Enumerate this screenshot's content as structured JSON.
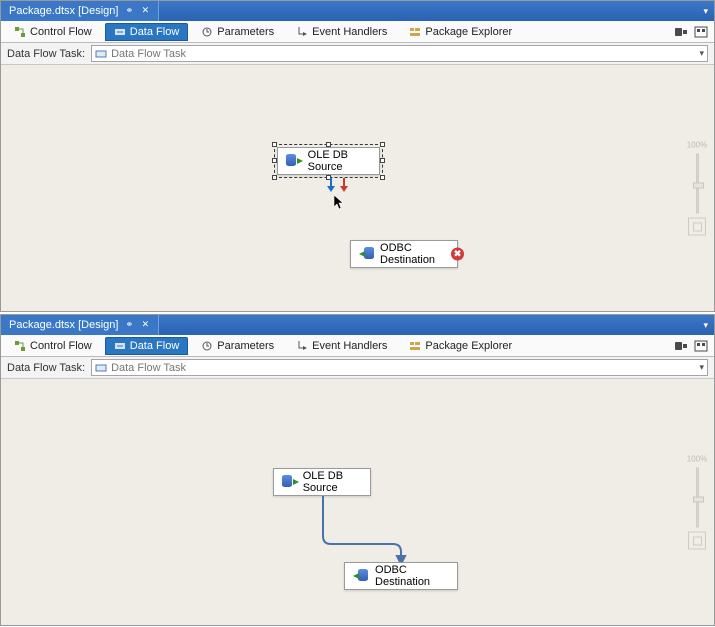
{
  "panels": [
    {
      "titleTab": {
        "label": "Package.dtsx [Design]",
        "pinGlyph": "⚭",
        "closeGlyph": "✕"
      },
      "tabs": {
        "controlFlow": "Control Flow",
        "dataFlow": "Data Flow",
        "parameters": "Parameters",
        "eventHandlers": "Event Handlers",
        "packageExplorer": "Package Explorer"
      },
      "toolbar": {
        "label": "Data Flow Task:",
        "selected": "Data Flow Task"
      },
      "nodes": {
        "source": {
          "label": "OLE DB Source"
        },
        "dest": {
          "label": "ODBC Destination",
          "errorGlyph": "✖"
        }
      },
      "zoom": {
        "percent": "100%"
      }
    },
    {
      "titleTab": {
        "label": "Package.dtsx [Design]",
        "pinGlyph": "⚭",
        "closeGlyph": "✕"
      },
      "tabs": {
        "controlFlow": "Control Flow",
        "dataFlow": "Data Flow",
        "parameters": "Parameters",
        "eventHandlers": "Event Handlers",
        "packageExplorer": "Package Explorer"
      },
      "toolbar": {
        "label": "Data Flow Task:",
        "selected": "Data Flow Task"
      },
      "nodes": {
        "source": {
          "label": "OLE DB Source"
        },
        "dest": {
          "label": "ODBC Destination"
        }
      },
      "zoom": {
        "percent": "100%"
      }
    }
  ]
}
